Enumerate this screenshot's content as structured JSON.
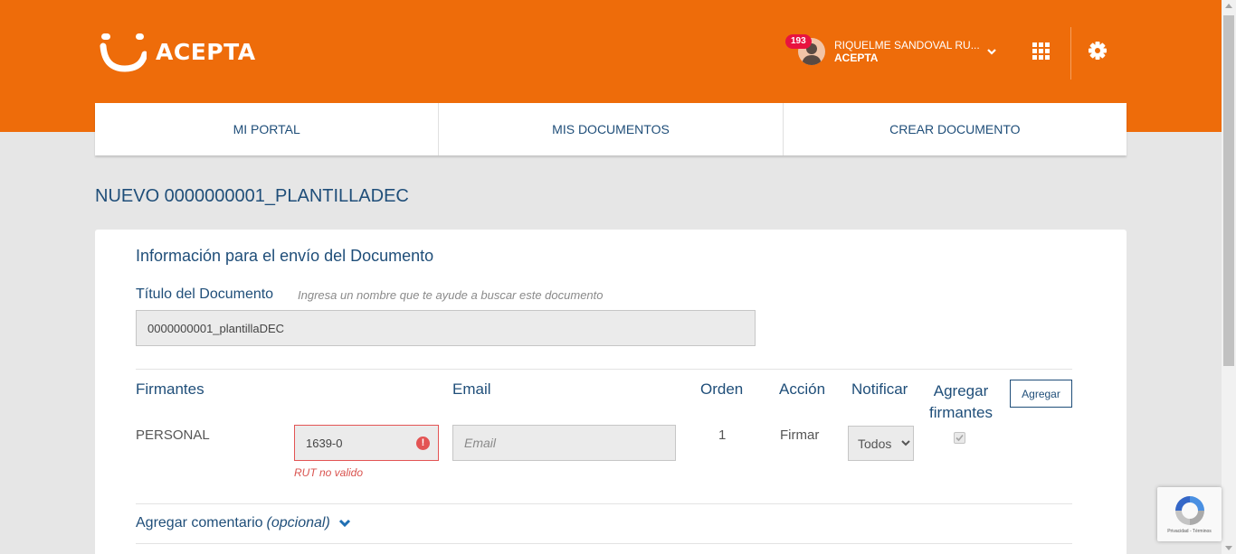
{
  "header": {
    "brand": "ACEPTA",
    "notification_count": "193",
    "user_name": "RIQUELME SANDOVAL RU...",
    "user_org": "ACEPTA"
  },
  "nav": {
    "tabs": [
      {
        "label": "MI PORTAL"
      },
      {
        "label": "MIS DOCUMENTOS"
      },
      {
        "label": "CREAR DOCUMENTO"
      }
    ]
  },
  "page": {
    "title": "NUEVO 0000000001_PLANTILLADEC"
  },
  "form": {
    "section_title": "Información para el envío del Documento",
    "doc_title_label": "Título del Documento",
    "doc_title_hint": "Ingresa un nombre que te ayude a buscar este documento",
    "doc_title_value": "0000000001_plantillaDEC",
    "signers": {
      "headers": {
        "firmantes": "Firmantes",
        "email": "Email",
        "orden": "Orden",
        "accion": "Acción",
        "notificar": "Notificar",
        "agregar_firmantes": "Agregar firmantes"
      },
      "add_button": "Agregar",
      "row": {
        "type": "PERSONAL",
        "rut_value": "1639-0",
        "rut_error": "RUT no valido",
        "email_placeholder": "Email",
        "order": "1",
        "action": "Firmar",
        "notify_selected": "Todos",
        "add_signers_checked": true
      }
    },
    "comment_label": "Agregar comentario",
    "comment_optional": "(opcional)"
  },
  "recaptcha": {
    "footer": "Privacidad - Términos"
  },
  "colors": {
    "brand_orange": "#ee6c0a",
    "text_blue": "#1f4e79",
    "error_red": "#e35454",
    "badge_red": "#e8133f"
  }
}
